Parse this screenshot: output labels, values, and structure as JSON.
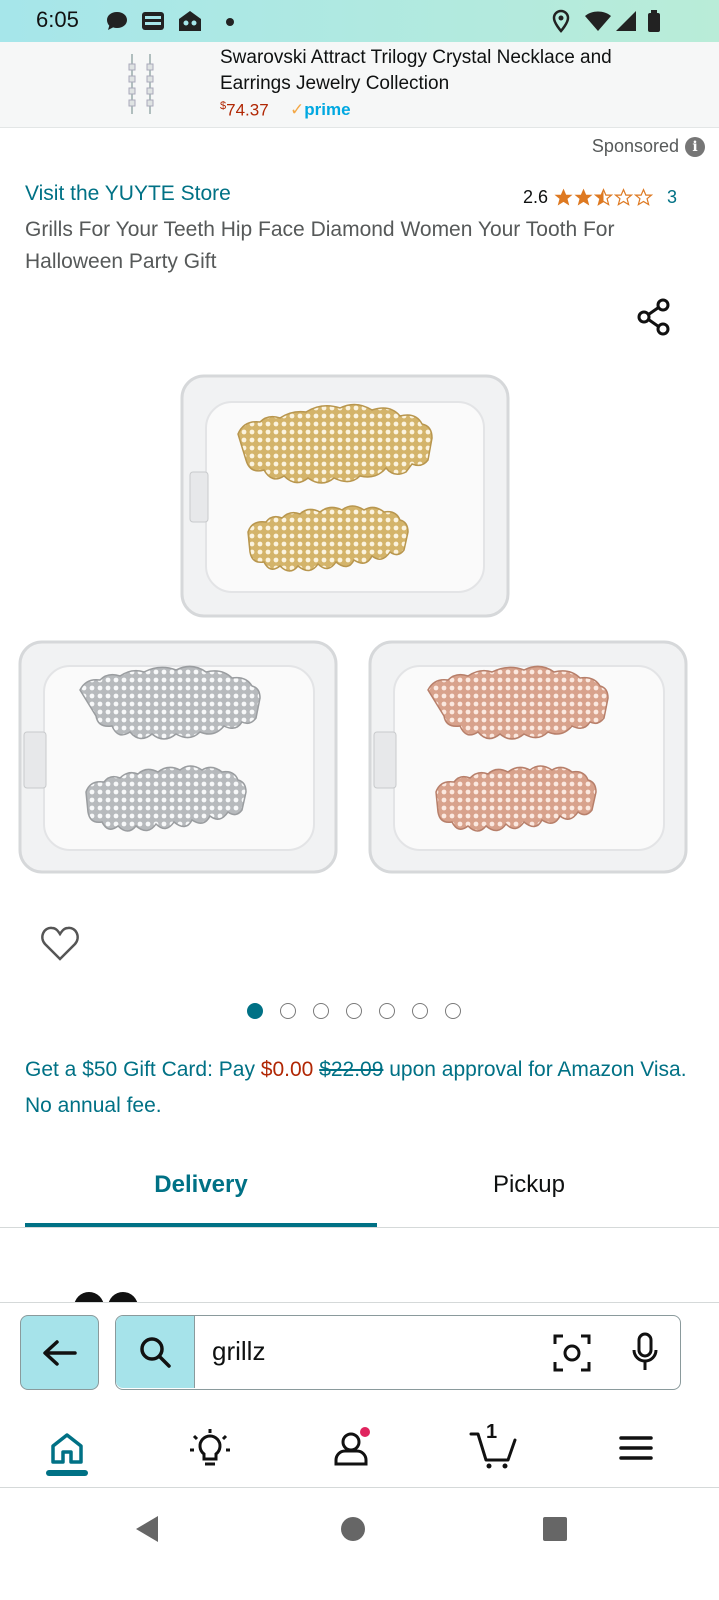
{
  "status_bar": {
    "time": "6:05",
    "icons": [
      "chat-bubble-icon",
      "news-app-icon",
      "mascot-app-icon",
      "dot-icon",
      "location-icon",
      "wifi-icon",
      "signal-icon",
      "battery-icon"
    ]
  },
  "ad": {
    "title": "Swarovski Attract Trilogy Crystal Necklace and Earrings Jewelry Collection",
    "price_symbol": "$",
    "price_value": "74.37",
    "prime_label": "prime",
    "image": "earrings-thumbnail"
  },
  "sponsored_label": "Sponsored",
  "product": {
    "store_link": "Visit the YUYTE Store",
    "rating_value": "2.6",
    "rating_stars": 2.5,
    "rating_count": "3",
    "title": "Grills For Your Teeth Hip Face Diamond Women Your Tooth For Halloween Party Gift",
    "image_description_icon": "grillz-product-image",
    "image_count": 7,
    "active_image_index": 0
  },
  "promo": {
    "prefix": "Get a $50 Gift Card: Pay ",
    "price_now": "$0.00",
    "price_old": "$22.09",
    "suffix": " upon approval for Amazon Visa. No annual fee."
  },
  "tabs": [
    {
      "label": "Delivery",
      "active": true
    },
    {
      "label": "Pickup",
      "active": false
    }
  ],
  "search": {
    "value": "grillz"
  },
  "bottom_nav": [
    "home-icon",
    "inspire-bulb-icon",
    "account-icon",
    "cart-icon",
    "menu-icon"
  ],
  "cart_count": "1",
  "colors": {
    "link": "#007185",
    "price_red": "#b12704",
    "accent_teal": "#a6e3ea",
    "star": "#de7921"
  }
}
